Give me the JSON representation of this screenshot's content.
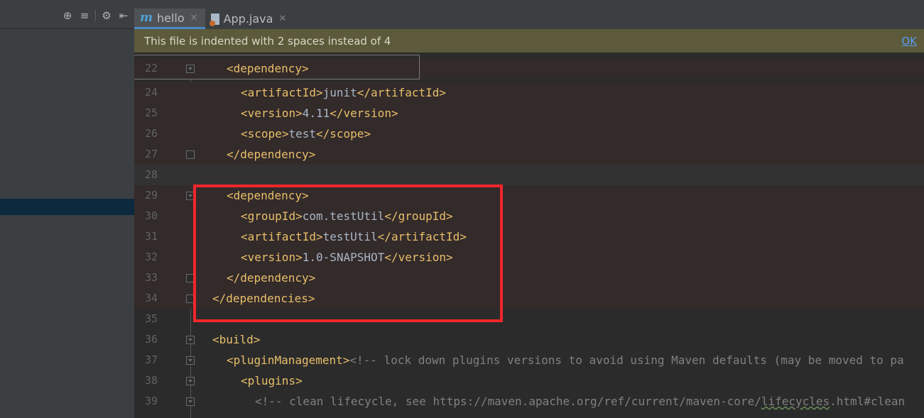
{
  "side_toolbar": {
    "icons": [
      "locate-icon",
      "collapse-all-icon",
      "settings-icon",
      "hide-panel-icon"
    ]
  },
  "tabs": [
    {
      "label": "hello",
      "icon": "maven-m-icon",
      "active": true
    },
    {
      "label": "App.java",
      "icon": "java-file-icon",
      "active": false
    }
  ],
  "notice": {
    "text": "This file is indented with 2 spaces instead of 4",
    "ok_label": "OK"
  },
  "editor": {
    "lines": [
      {
        "n": "22",
        "html": "  <span class='br'>&lt;</span><span class='tg'>dependency</span><span class='br'>&gt;</span>"
      },
      {
        "n": "24",
        "html": "    <span class='br'>&lt;</span><span class='tg'>artifactId</span><span class='br'>&gt;</span>junit<span class='br'>&lt;/</span><span class='tg'>artifactId</span><span class='br'>&gt;</span>"
      },
      {
        "n": "25",
        "html": "    <span class='br'>&lt;</span><span class='tg'>version</span><span class='br'>&gt;</span>4.11<span class='br'>&lt;/</span><span class='tg'>version</span><span class='br'>&gt;</span>"
      },
      {
        "n": "26",
        "html": "    <span class='br'>&lt;</span><span class='tg'>scope</span><span class='br'>&gt;</span>test<span class='br'>&lt;/</span><span class='tg'>scope</span><span class='br'>&gt;</span>"
      },
      {
        "n": "27",
        "html": "  <span class='br'>&lt;/</span><span class='tg'>dependency</span><span class='br'>&gt;</span>"
      },
      {
        "n": "28",
        "html": ""
      },
      {
        "n": "29",
        "html": "  <span class='br'>&lt;</span><span class='tg'>dependency</span><span class='br'>&gt;</span>"
      },
      {
        "n": "30",
        "html": "    <span class='br'>&lt;</span><span class='tg'>groupId</span><span class='br'>&gt;</span>com.testUtil<span class='br'>&lt;/</span><span class='tg'>groupId</span><span class='br'>&gt;</span>"
      },
      {
        "n": "31",
        "html": "    <span class='br'>&lt;</span><span class='tg'>artifactId</span><span class='br'>&gt;</span>testUtil<span class='br'>&lt;/</span><span class='tg'>artifactId</span><span class='br'>&gt;</span>"
      },
      {
        "n": "32",
        "html": "    <span class='br'>&lt;</span><span class='tg'>version</span><span class='br'>&gt;</span>1.0-SNAPSHOT<span class='br'>&lt;/</span><span class='tg'>version</span><span class='br'>&gt;</span>"
      },
      {
        "n": "33",
        "html": "  <span class='br'>&lt;/</span><span class='tg'>dependency</span><span class='br'>&gt;</span>"
      },
      {
        "n": "34",
        "html": "<span class='br'>&lt;/</span><span class='tg'>dependencies</span><span class='br'>&gt;</span>"
      },
      {
        "n": "35",
        "html": ""
      },
      {
        "n": "36",
        "html": "<span class='br'>&lt;</span><span class='tg'>build</span><span class='br'>&gt;</span>"
      },
      {
        "n": "37",
        "html": "  <span class='br'>&lt;</span><span class='tg'>pluginManagement</span><span class='br'>&gt;</span><span class='cm'>&lt;!-- lock down plugins versions to avoid using Maven defaults (may be moved to pa</span>"
      },
      {
        "n": "38",
        "html": "    <span class='br'>&lt;</span><span class='tg'>plugins</span><span class='br'>&gt;</span>"
      },
      {
        "n": "39",
        "html": "      <span class='cm'>&lt;!-- clean lifecycle, see https://maven.apache.org/ref/current/maven-core/<span class='ul'>lifecycles</span>.html#clean</span>"
      }
    ]
  }
}
